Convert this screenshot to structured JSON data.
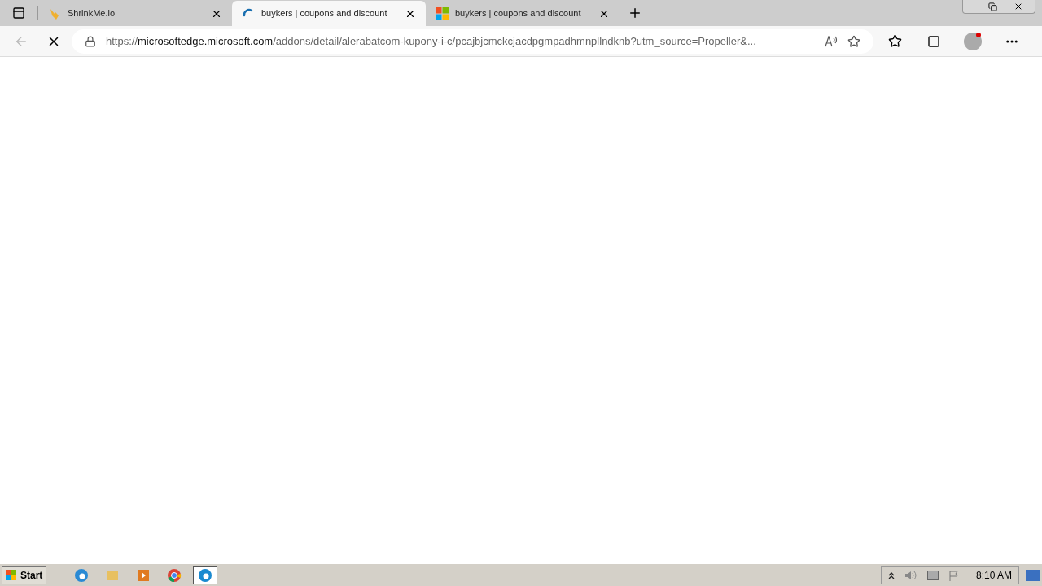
{
  "tabs": [
    {
      "title": "ShrinkMe.io",
      "kind": "hand",
      "selected": false
    },
    {
      "title": "buykers | coupons and discount",
      "kind": "loading",
      "selected": true
    },
    {
      "title": "buykers | coupons and discount",
      "kind": "windows",
      "selected": false
    }
  ],
  "address": {
    "scheme": "https://",
    "host": "microsoftedge.microsoft.com",
    "path": "/addons/detail/alerabatcom-kupony-i-c/pcajbjcmckcjacdpgmpadhmnpllndknb?utm_source=Propeller&..."
  },
  "loading": true,
  "taskbar": {
    "start": "Start",
    "apps": [
      {
        "kind": "ie",
        "selected": false
      },
      {
        "kind": "folder",
        "selected": false
      },
      {
        "kind": "media",
        "selected": false
      },
      {
        "kind": "chrome",
        "selected": false
      },
      {
        "kind": "edge",
        "selected": true
      }
    ],
    "clock": "8:10 AM"
  }
}
